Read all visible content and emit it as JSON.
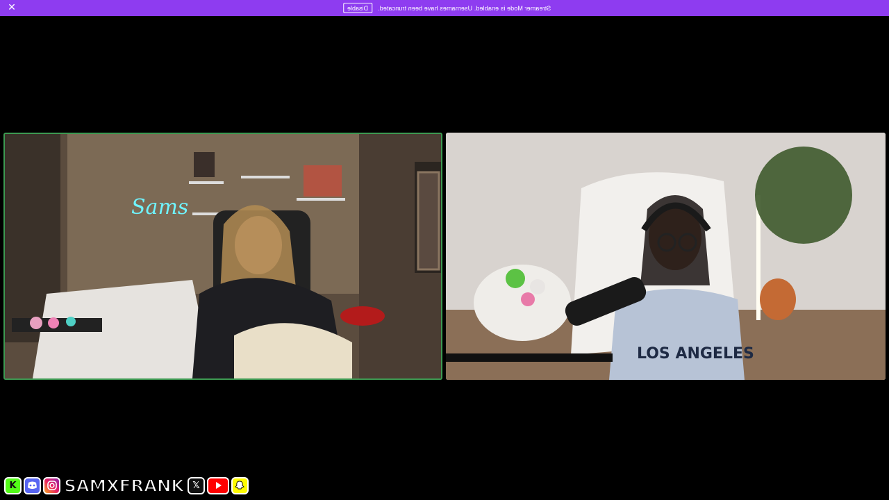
{
  "banner": {
    "message": "Streamer Mode is enabled. Usernames have been truncated.",
    "disable_label": "Disable",
    "close_icon": "close-icon",
    "color": "#8e3cf0"
  },
  "stream": {
    "left_camera_border": "#3d9a52",
    "neon_sign": "Sams"
  },
  "social": {
    "handle": "SAMXFRANK",
    "icons": [
      "kick-icon",
      "discord-icon",
      "instagram-icon",
      "x-icon",
      "youtube-icon",
      "snapchat-icon"
    ]
  }
}
